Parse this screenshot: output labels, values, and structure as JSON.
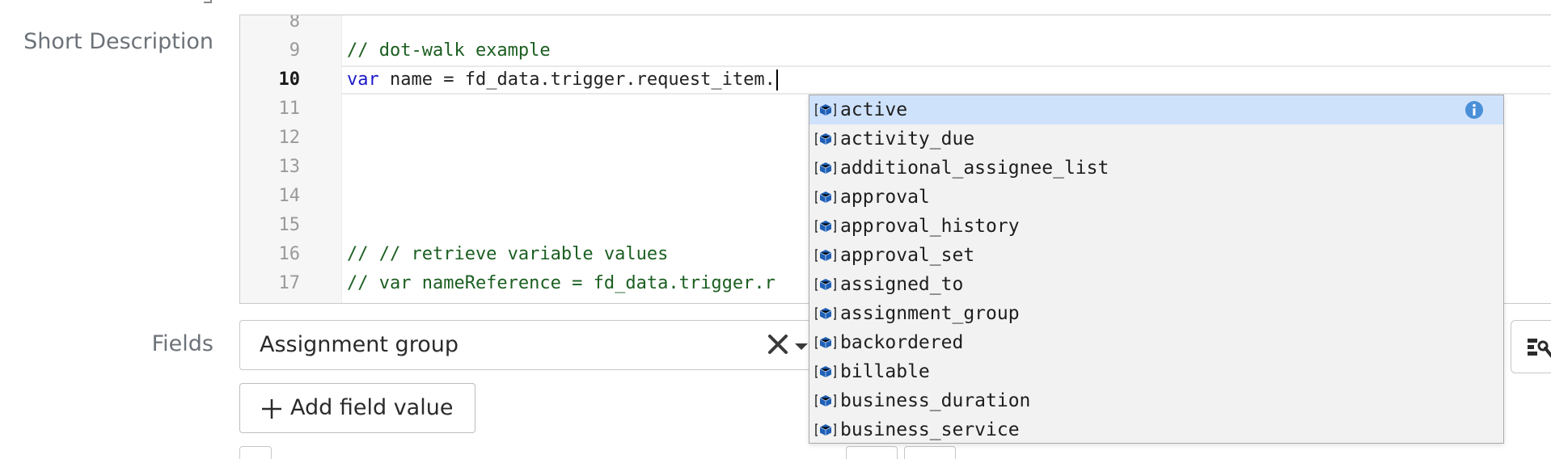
{
  "form": {
    "short_description_label": "Short Description",
    "fields_label": "Fields",
    "fields_value": "Assignment group",
    "add_field_value_label": "Add field value"
  },
  "editor": {
    "lines": [
      {
        "number": "8",
        "text": ""
      },
      {
        "number": "9",
        "text": "// dot-walk example"
      },
      {
        "number": "10",
        "text": "fd_data.trigger.request_item.",
        "keyword": "var",
        "middle": " name = "
      },
      {
        "number": "11",
        "text": ""
      },
      {
        "number": "12",
        "text": ""
      },
      {
        "number": "13",
        "text": ""
      },
      {
        "number": "14",
        "text": ""
      },
      {
        "number": "15",
        "text": ""
      },
      {
        "number": "16",
        "text": "// // retrieve variable values"
      },
      {
        "number": "17",
        "text": "// var nameReference = fd_data.trigger.r"
      }
    ]
  },
  "autocomplete": {
    "items": [
      "active",
      "activity_due",
      "additional_assignee_list",
      "approval",
      "approval_history",
      "approval_set",
      "assigned_to",
      "assignment_group",
      "backordered",
      "billable",
      "business_duration",
      "business_service"
    ],
    "selected_index": 0,
    "item_icon": "field-cube-icon"
  },
  "colors": {
    "comment": "#1b5e20",
    "keyword": "#1c19c9",
    "selected_item_bg": "#cfe2fb",
    "info_icon": "#4a90d9"
  }
}
